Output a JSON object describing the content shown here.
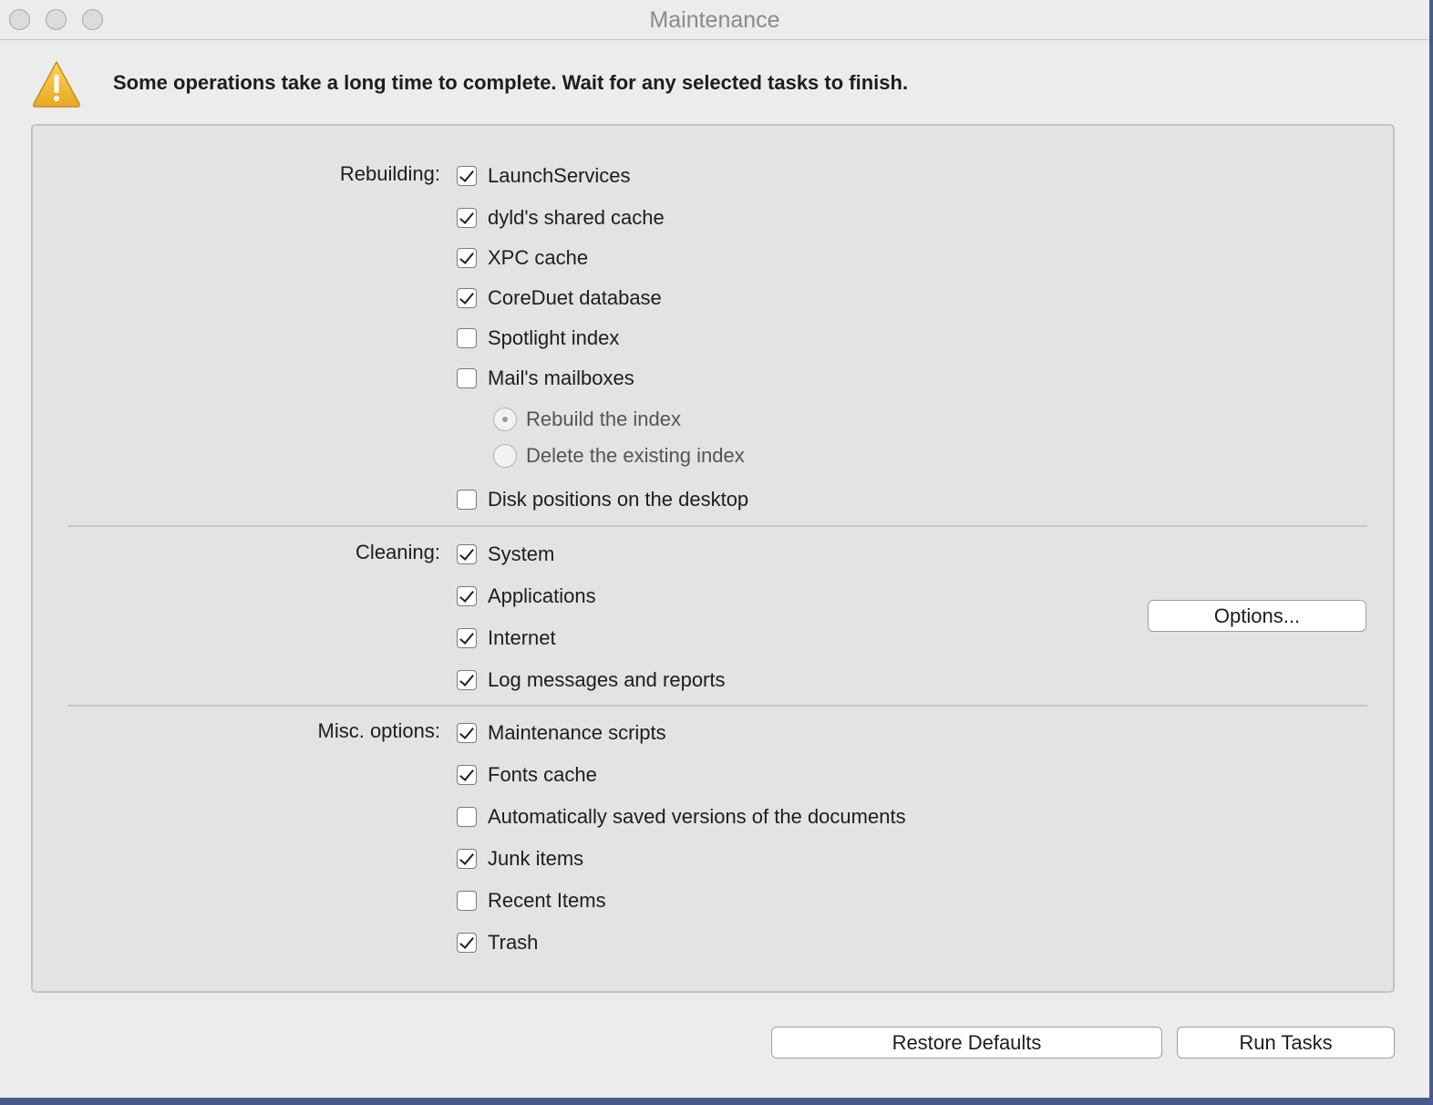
{
  "window": {
    "title": "Maintenance"
  },
  "warning": {
    "icon": "warning-triangle-icon",
    "message": "Some operations take a long time to complete. Wait for any selected tasks to finish."
  },
  "rebuilding": {
    "label": "Rebuilding:",
    "items": [
      {
        "label": "LaunchServices",
        "checked": true
      },
      {
        "label": "dyld's shared cache",
        "checked": true
      },
      {
        "label": "XPC cache",
        "checked": true
      },
      {
        "label": "CoreDuet database",
        "checked": true
      },
      {
        "label": "Spotlight index",
        "checked": false
      },
      {
        "label": "Mail's mailboxes",
        "checked": false
      }
    ],
    "mail_options": [
      {
        "label": "Rebuild the index",
        "selected": true
      },
      {
        "label": "Delete the existing index",
        "selected": false
      }
    ],
    "disk_positions": {
      "label": "Disk positions on the desktop",
      "checked": false
    }
  },
  "cleaning": {
    "label": "Cleaning:",
    "items": [
      {
        "label": "System",
        "checked": true
      },
      {
        "label": "Applications",
        "checked": true
      },
      {
        "label": "Internet",
        "checked": true
      },
      {
        "label": "Log messages and reports",
        "checked": true
      }
    ],
    "options_button": "Options..."
  },
  "misc": {
    "label": "Misc. options:",
    "items": [
      {
        "label": "Maintenance scripts",
        "checked": true
      },
      {
        "label": "Fonts cache",
        "checked": true
      },
      {
        "label": "Automatically saved versions of the documents",
        "checked": false
      },
      {
        "label": "Junk items",
        "checked": true
      },
      {
        "label": "Recent Items",
        "checked": false
      },
      {
        "label": "Trash",
        "checked": true
      }
    ]
  },
  "footer": {
    "restore_defaults": "Restore Defaults",
    "run_tasks": "Run Tasks"
  }
}
